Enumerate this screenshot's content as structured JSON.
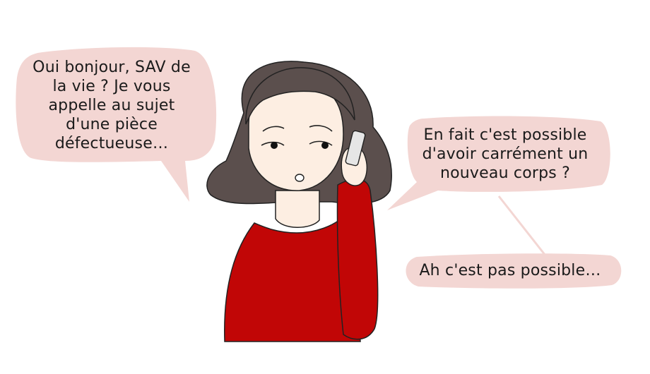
{
  "comic": {
    "bubbles": [
      {
        "lines": [
          "Oui bonjour, SAV de",
          "la vie ? Je vous",
          "appelle au sujet",
          "d'une pièce",
          "défectueuse…"
        ]
      },
      {
        "lines": [
          "En fait c'est possible",
          "d'avoir carrément un",
          "nouveau corps ?"
        ]
      },
      {
        "lines": [
          "Ah c'est pas possible…"
        ]
      }
    ],
    "character": {
      "icon": "woman-on-phone",
      "colors": {
        "hair": "#5b4f4d",
        "skin": "#fdeee2",
        "shirt": "#c10606",
        "phone": "#e6e6e6"
      }
    },
    "colors": {
      "bubble": "#f3d6d3",
      "text": "#1a1a1a",
      "outline": "#222222"
    }
  }
}
